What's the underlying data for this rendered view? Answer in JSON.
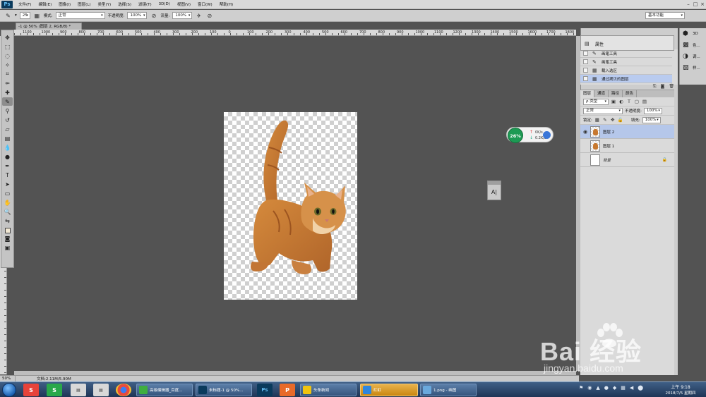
{
  "menubar": {
    "logo": "Ps",
    "items": [
      "文件(F)",
      "编辑(E)",
      "图像(I)",
      "图层(L)",
      "类型(Y)",
      "选择(S)",
      "滤镜(T)",
      "3D(D)",
      "视图(V)",
      "窗口(W)",
      "帮助(H)"
    ],
    "window_controls": [
      "–",
      "□",
      "×"
    ]
  },
  "options": {
    "brush_size": "25",
    "mode_label": "模式:",
    "mode_value": "正常",
    "opacity_label": "不透明度:",
    "opacity_value": "100%",
    "flow_label": "流量:",
    "flow_value": "100%",
    "workspace": "基本功能"
  },
  "document": {
    "tab_title": "-1 @ 50% (图层 2, RGB/8) *",
    "ruler_top_ticks": [
      "1100",
      "1000",
      "900",
      "800",
      "700",
      "600",
      "500",
      "400",
      "300",
      "200",
      "100",
      "0",
      "100",
      "200",
      "300",
      "400",
      "500",
      "600",
      "700",
      "800",
      "900",
      "1000",
      "1100",
      "1200",
      "1300",
      "1400",
      "1500",
      "1600",
      "1700",
      "1800"
    ]
  },
  "net_widget": {
    "percent": "26%",
    "upload": "0K/s",
    "download": "0.2K/s"
  },
  "char_panel": {
    "label": "A|"
  },
  "properties": {
    "label": "属性"
  },
  "history": {
    "items": [
      {
        "label": "画笔工具",
        "selected": false
      },
      {
        "label": "画笔工具",
        "selected": false
      },
      {
        "label": "载入选区",
        "selected": false
      },
      {
        "label": "通过拷贝的图层",
        "selected": true
      }
    ]
  },
  "layers": {
    "tabs": [
      "图层",
      "通道",
      "路径",
      "颜色"
    ],
    "filter_label": "ρ 类型",
    "blend_mode": "正常",
    "opacity_label": "不透明度:",
    "opacity_value": "100%",
    "lock_label": "锁定:",
    "fill_label": "填充:",
    "fill_value": "100%",
    "items": [
      {
        "name": "图层 2",
        "selected": true,
        "visible": true
      },
      {
        "name": "图层 1",
        "selected": false,
        "visible": false
      },
      {
        "name": "背景",
        "selected": false,
        "visible": false
      }
    ]
  },
  "icon_column": {
    "items": [
      {
        "icon": "3d-icon",
        "label": "3D"
      },
      {
        "icon": "color-icon",
        "label": "色..."
      },
      {
        "icon": "adjust-icon",
        "label": "调..."
      },
      {
        "icon": "style-icon",
        "label": "样..."
      }
    ]
  },
  "status": {
    "zoom": "50%",
    "doc_info": "文档:2.11M/5.90M"
  },
  "taskbar": {
    "tasks": [
      {
        "title": "高级编辑器_百度...",
        "color": "#3fae3f",
        "active": false
      },
      {
        "title": "未标题-1 @ 50%...",
        "color": "#0a3a5c",
        "active": false
      },
      {
        "title": "头条新闻",
        "color": "#f1c40f",
        "active": false
      },
      {
        "title": "红虹",
        "color": "#2e86de",
        "active": true
      },
      {
        "title": "1.png - 画图",
        "color": "#6aa9dd",
        "active": false
      }
    ],
    "clock_time": "上午 9:18",
    "clock_date": "2018/7/5 星期四"
  },
  "watermark": {
    "brand": "Bai  经验",
    "url": "jingyan.baidu.com"
  },
  "colors": {
    "workspace_bg": "#535353",
    "selection": "#b5c7ea",
    "cat": "#c7782e"
  }
}
